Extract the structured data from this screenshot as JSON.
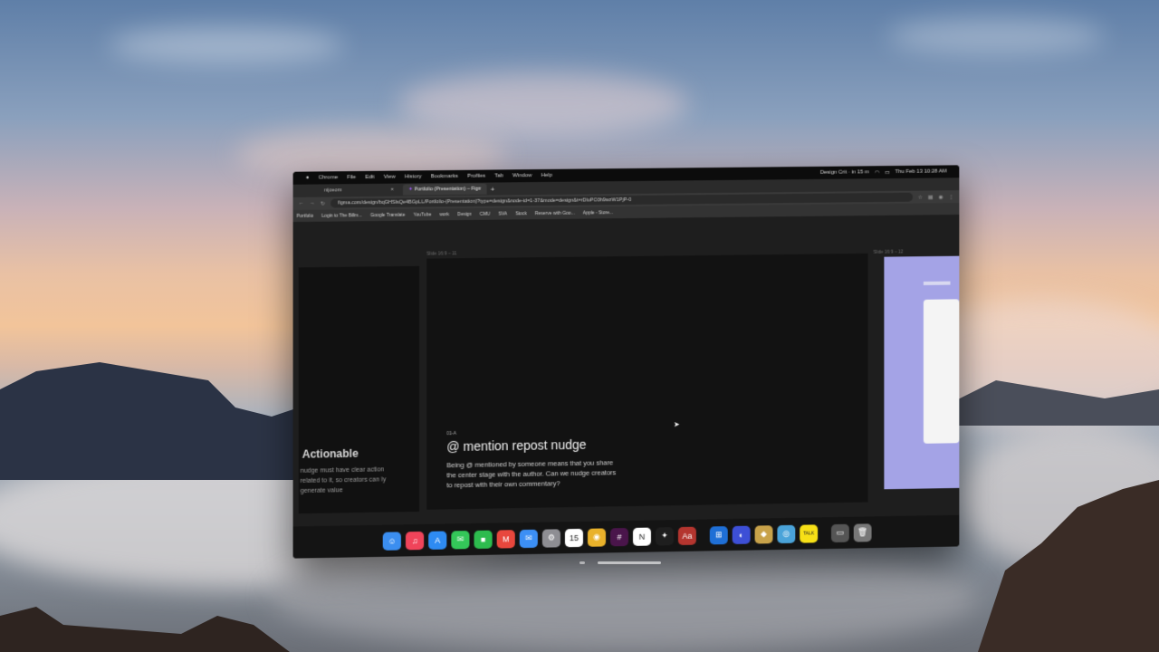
{
  "menubar": {
    "items": [
      "Chrome",
      "File",
      "Edit",
      "View",
      "History",
      "Bookmarks",
      "Profiles",
      "Tab",
      "Window",
      "Help"
    ],
    "status": "Design Crit · in 15 m",
    "clock": "Thu Feb 13 10:28 AM"
  },
  "tabs": [
    {
      "label": "nijoeom"
    },
    {
      "label": "Portfolio (Presentation) – Figma"
    }
  ],
  "address": {
    "url": "figma.com/design/bqGHSlsQe4BGpLL/Portfolio-(Presentation)?type=design&node-id=1-37&mode=design&t=rDluPO3h9wzW1PjP-0"
  },
  "bookmarks": [
    "Portfolio",
    "Login to The Billm...",
    "Google Translate",
    "YouTube",
    "work",
    "Design",
    "CMU",
    "SVA",
    "Stock",
    "Reserve with Goo...",
    "Apple - Store..."
  ],
  "canvas": {
    "left_frame": {
      "heading": "Actionable",
      "body": "nudge must have clear action related to it, so creators can ly generate value"
    },
    "main_frame": {
      "label_small": "01-A",
      "title": "@ mention repost nudge",
      "body": "Being @ mentioned by someone means that you share the center stage with the author. Can we nudge creators to repost with their own commentary?"
    },
    "right_frame": {
      "label": "Slide 16:9 – 12"
    },
    "main_frame_label": "Slide 16:9 – 11"
  },
  "dock": {
    "apps": [
      {
        "name": "finder-icon",
        "glyph": "☺",
        "color": "#3b8ef0"
      },
      {
        "name": "music-icon",
        "glyph": "♫",
        "color": "#f0445a"
      },
      {
        "name": "app-store-icon",
        "glyph": "A",
        "color": "#2e8bf2"
      },
      {
        "name": "messages-icon",
        "glyph": "✉",
        "color": "#34c759"
      },
      {
        "name": "facetime-icon",
        "glyph": "■",
        "color": "#2dbb4e"
      },
      {
        "name": "gmail-icon",
        "glyph": "M",
        "color": "#e8473d"
      },
      {
        "name": "mail-icon",
        "glyph": "✉",
        "color": "#3c8ff5"
      },
      {
        "name": "system-settings-icon",
        "glyph": "⚙",
        "color": "#8e8e93"
      },
      {
        "name": "calendar-icon",
        "glyph": "15",
        "color": "#ffffff"
      },
      {
        "name": "chrome-icon",
        "glyph": "◉",
        "color": "#e9b22b"
      },
      {
        "name": "slack-icon",
        "glyph": "#",
        "color": "#4a154b"
      },
      {
        "name": "notion-icon",
        "glyph": "N",
        "color": "#ffffff"
      },
      {
        "name": "figma-icon",
        "glyph": "✦",
        "color": "#1e1e1e"
      },
      {
        "name": "dictionary-icon",
        "glyph": "Aa",
        "color": "#b4352f"
      },
      {
        "name": "windows-app-icon",
        "glyph": "⊞",
        "color": "#1f6fd6"
      },
      {
        "name": "arc-icon",
        "glyph": "◐",
        "color": "#3d4fd6"
      },
      {
        "name": "league-icon",
        "glyph": "◆",
        "color": "#c8a24a"
      },
      {
        "name": "preview-icon",
        "glyph": "◎",
        "color": "#4aa3d9"
      },
      {
        "name": "kakaotalk-icon",
        "glyph": "TALK",
        "color": "#f7e017"
      },
      {
        "name": "screenshot-icon",
        "glyph": "▭",
        "color": "#555555"
      },
      {
        "name": "trash-icon",
        "glyph": "🗑",
        "color": "#777777"
      }
    ]
  }
}
